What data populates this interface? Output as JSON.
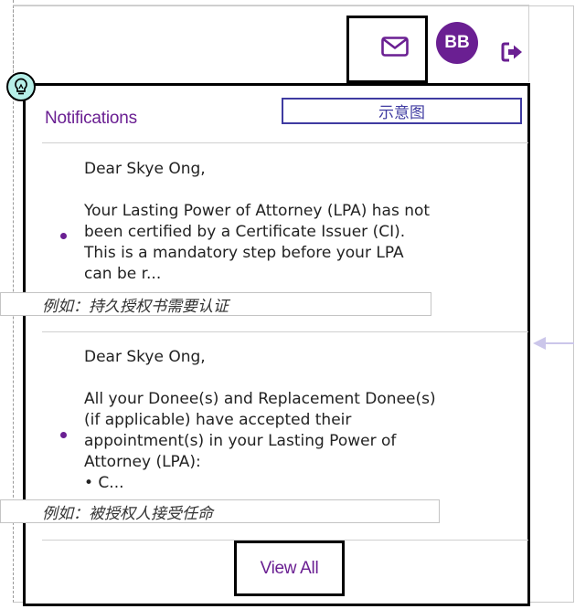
{
  "header": {
    "mail_icon": "envelope-icon",
    "avatar_initials": "BB",
    "logout_icon": "sign-out-icon",
    "accent_color": "#6a1f92"
  },
  "annotation": {
    "bulb_icon": "lightbulb-icon",
    "label": "示意图"
  },
  "notifications": {
    "title": "Notifications",
    "items": [
      {
        "greeting": "Dear Skye Ong,",
        "lines": [
          "Your Lasting Power of Attorney (LPA) has not",
          "been certified by a Certificate Issuer (CI).",
          "This is a mandatory step before your LPA",
          "can be r..."
        ],
        "note": "例如：持久授权书需要认证"
      },
      {
        "greeting": "Dear Skye Ong,",
        "lines": [
          "All your Donee(s) and Replacement Donee(s)",
          "(if applicable) have accepted their",
          "appointment(s) in your Lasting Power of",
          "Attorney (LPA):",
          "• C..."
        ],
        "note": "例如：被授权人接受任命"
      }
    ],
    "view_all": "View All"
  }
}
